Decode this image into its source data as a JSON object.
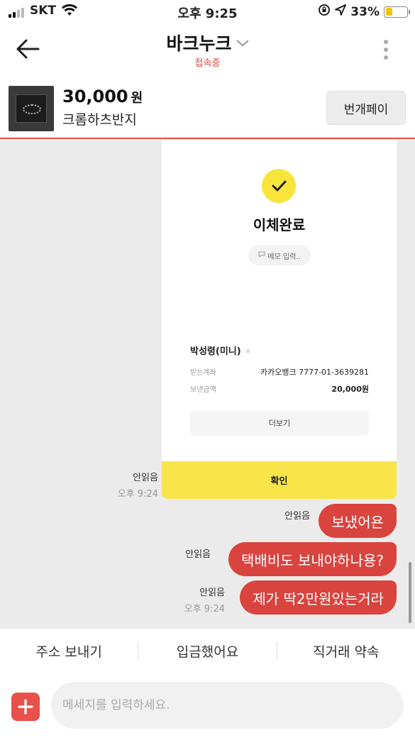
{
  "status_bar": {
    "carrier": "SKT",
    "time": "오후 9:25",
    "battery": "33%",
    "battery_level": 0.33,
    "battery_color": "#f4c400"
  },
  "header": {
    "title": "바크누크",
    "status": "접속중",
    "icons": [
      "back-arrow-icon",
      "chevron-down-icon",
      "more-vertical-icon"
    ]
  },
  "product": {
    "price": "30,000",
    "currency": "원",
    "name": "크롬하츠반지",
    "pay_button": "번개페이"
  },
  "transfer_card": {
    "title": "이체완료",
    "memo": "메모 입력..",
    "recipient": "박성령(미니)",
    "rows": [
      {
        "label": "받는계좌",
        "value": "카카오뱅크 7777-01-3639281"
      },
      {
        "label": "보낸금액",
        "value": "20,000원"
      }
    ],
    "more_button": "더보기",
    "confirm_button": "확인",
    "unread": "안읽음",
    "timestamp": "오후 9:24"
  },
  "messages": [
    {
      "text": "보냈어욘",
      "unread": "안읽음",
      "timestamp": ""
    },
    {
      "text": "택배비도 보내야하나용?",
      "unread": "안읽음",
      "timestamp": ""
    },
    {
      "text": "제가 딱2만원있는거라",
      "unread": "안읽음",
      "timestamp": "오후 9:24"
    }
  ],
  "quick_actions": [
    "주소 보내기",
    "입금했어요",
    "직거래 약속"
  ],
  "input": {
    "placeholder": "메세지를 입력하세요."
  },
  "colors": {
    "accent": "#d9443f",
    "confirm_yellow": "#f7e54a",
    "chat_bg": "#ebebeb"
  }
}
